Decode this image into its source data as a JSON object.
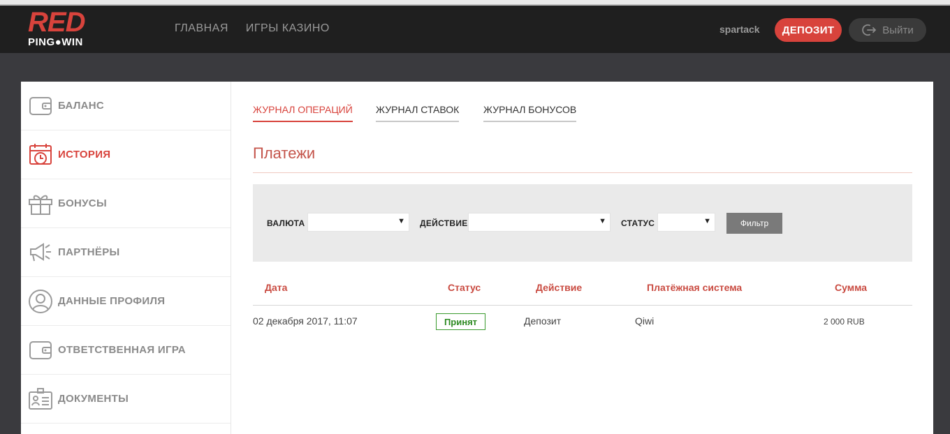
{
  "header": {
    "logo_top": "RED",
    "logo_bottom": "PING●WIN",
    "nav": [
      "ГЛАВНАЯ",
      "ИГРЫ КАЗИНО"
    ],
    "username": "spartack",
    "deposit_label": "ДЕПОЗИТ",
    "logout_label": "Выйти"
  },
  "sidebar": {
    "items": [
      {
        "label": "БАЛАНС",
        "icon": "wallet-icon"
      },
      {
        "label": "ИСТОРИЯ",
        "icon": "calendar-clock-icon"
      },
      {
        "label": "БОНУСЫ",
        "icon": "gift-icon"
      },
      {
        "label": "ПАРТНЁРЫ",
        "icon": "megaphone-icon"
      },
      {
        "label": "ДАННЫЕ ПРОФИЛЯ",
        "icon": "user-icon"
      },
      {
        "label": "ОТВЕТСТВЕННАЯ ИГРА",
        "icon": "wallet-icon"
      },
      {
        "label": "ДОКУМЕНТЫ",
        "icon": "id-card-icon"
      }
    ],
    "active_index": 1
  },
  "tabs": [
    "ЖУРНАЛ ОПЕРАЦИЙ",
    "ЖУРНАЛ СТАВОК",
    "ЖУРНАЛ БОНУСОВ"
  ],
  "section_title": "Платежи",
  "filter": {
    "currency_label": "ВАЛЮТА",
    "action_label": "ДЕЙСТВИЕ",
    "status_label": "СТАТУС",
    "currency_value": "",
    "action_value": "",
    "status_value": "",
    "button_label": "Фильтр"
  },
  "table": {
    "headers": [
      "Дата",
      "Статус",
      "Действие",
      "Платёжная система",
      "Сумма"
    ],
    "rows": [
      {
        "date": "02 декабря 2017, 11:07",
        "status": "Принят",
        "action": "Депозит",
        "system": "Qiwi",
        "amount": "2 000 RUB"
      }
    ]
  },
  "colors": {
    "accent": "#d8433c",
    "success": "#2d8a22",
    "header_bg": "#1f1f1f"
  }
}
